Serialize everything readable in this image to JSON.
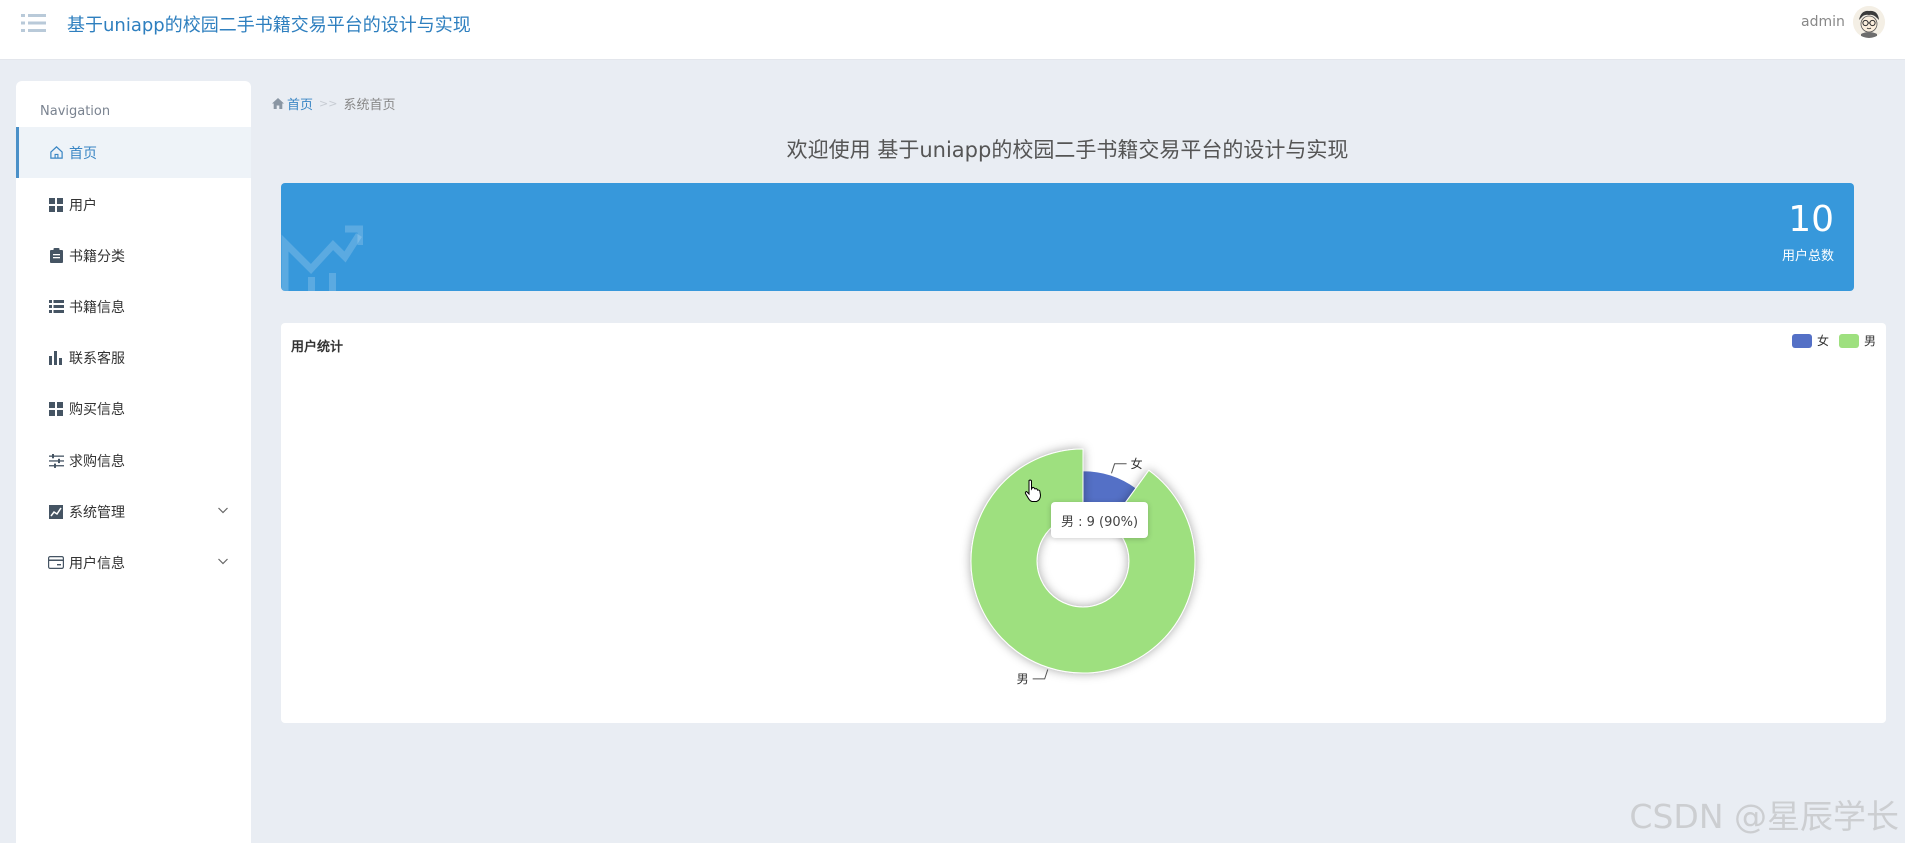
{
  "header": {
    "app_title": "基于uniapp的校园二手书籍交易平台的设计与实现",
    "user_name": "admin",
    "menu_icon": "menu-icon",
    "avatar_icon": "avatar-icon"
  },
  "sidebar": {
    "caption": "Navigation",
    "items": [
      {
        "label": "首页",
        "icon": "home-icon",
        "active": true
      },
      {
        "label": "用户",
        "icon": "grid-icon"
      },
      {
        "label": "书籍分类",
        "icon": "clipboard-icon"
      },
      {
        "label": "书籍信息",
        "icon": "list-icon"
      },
      {
        "label": "联系客服",
        "icon": "bar-chart-icon"
      },
      {
        "label": "购买信息",
        "icon": "grid-icon"
      },
      {
        "label": "求购信息",
        "icon": "sliders-icon"
      },
      {
        "label": "系统管理",
        "icon": "line-chart-icon",
        "expandable": true
      },
      {
        "label": "用户信息",
        "icon": "card-icon",
        "expandable": true
      }
    ]
  },
  "breadcrumb": {
    "home": "首页",
    "separator": ">>",
    "current": "系统首页"
  },
  "welcome": "欢迎使用 基于uniapp的校园二手书籍交易平台的设计与实现",
  "stat_card": {
    "value": "10",
    "label": "用户总数",
    "color": "#3798db"
  },
  "chart": {
    "title": "用户统计",
    "legend": [
      "女",
      "男"
    ],
    "tooltip": "男 : 9 (90%)"
  },
  "chart_data": {
    "type": "pie",
    "title": "用户统计",
    "categories": [
      "女",
      "男"
    ],
    "values": [
      1,
      9
    ],
    "colors": [
      "#5470c6",
      "#9ee07f"
    ],
    "legend_position": "top-right",
    "donut": true
  },
  "watermark": "CSDN @星辰学长"
}
